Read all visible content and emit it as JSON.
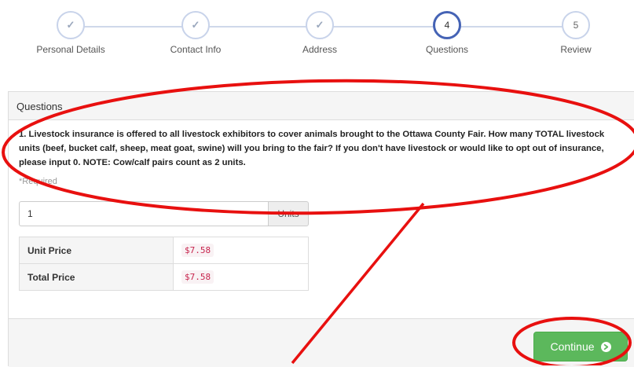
{
  "stepper": {
    "steps": [
      {
        "label": "Personal Details",
        "state": "complete",
        "number": ""
      },
      {
        "label": "Contact Info",
        "state": "complete",
        "number": ""
      },
      {
        "label": "Address",
        "state": "complete",
        "number": ""
      },
      {
        "label": "Questions",
        "state": "active",
        "number": "4"
      },
      {
        "label": "Review",
        "state": "pending",
        "number": "5"
      }
    ]
  },
  "panel": {
    "heading": "Questions",
    "question": "1. Livestock insurance is offered to all livestock exhibitors to cover animals brought to the Ottawa County Fair. How many TOTAL livestock units (beef, bucket calf, sheep, meat goat, swine) will you bring to the fair? If you don't have livestock or would like to opt out of insurance, please input 0. NOTE: Cow/calf pairs count as 2 units.",
    "required": "*Required",
    "quantity_value": "1",
    "units_addon": "Units",
    "pricing": [
      {
        "label": "Unit Price",
        "value": "$7.58"
      },
      {
        "label": "Total Price",
        "value": "$7.58"
      }
    ]
  },
  "footer": {
    "continue_label": "Continue"
  },
  "colors": {
    "accent": "#4563b5",
    "success": "#5cb85c",
    "annotation": "#e8100f"
  }
}
